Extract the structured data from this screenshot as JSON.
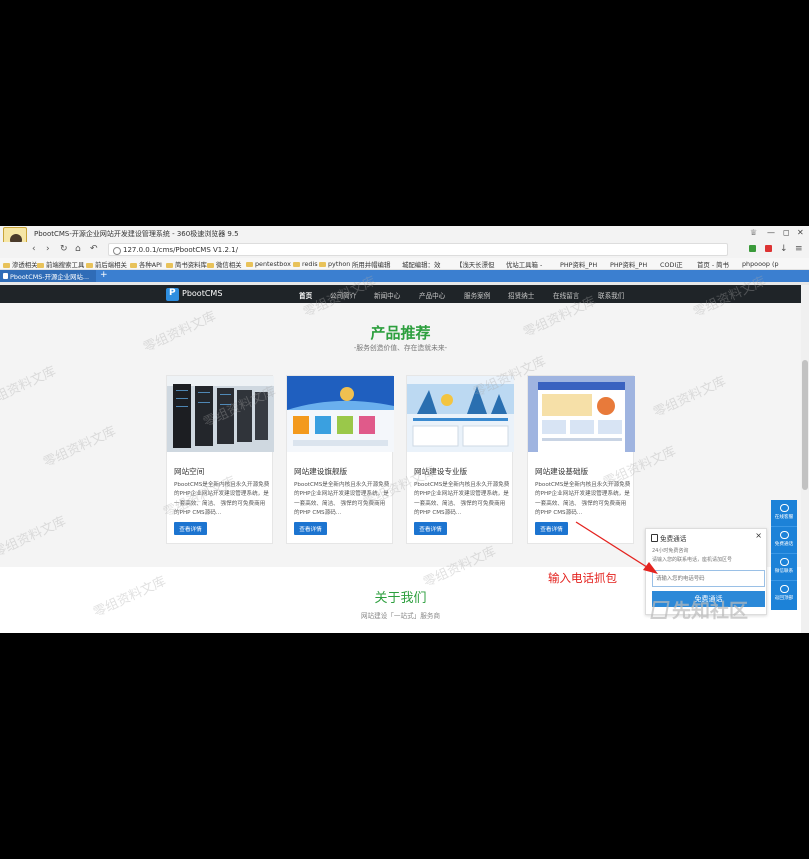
{
  "browser": {
    "window_title": "PbootCMS-开源企业网站开发建设管理系统 - 360极速浏览器 9.5",
    "url": "127.0.0.1/cms/PbootCMS V1.2.1/",
    "tab_title": "PbootCMS-开源企业网站...",
    "bookmarks": [
      "渗透相关",
      "前端搜索工具",
      "前后端相关",
      "各种API",
      "简书资料库",
      "微信相关",
      "pentestbox",
      "redis",
      "python",
      "所用并帽编辑",
      "城配编辑：效",
      "【浅天长漂但",
      "优站工具箱 -",
      "PHP资料_PH",
      "PHP资料_PH",
      "CODI正",
      "首页 - 简书",
      "phpooop (p"
    ]
  },
  "site": {
    "brand": "PbootCMS",
    "nav": [
      "首页",
      "公司简介",
      "新闻中心",
      "产品中心",
      "服务案例",
      "招贤纳士",
      "在线留言",
      "联系我们"
    ]
  },
  "products": {
    "title": "产品推荐",
    "subtitle": "-服务创造价值、存在造就未来-",
    "items": [
      {
        "name": "网站空间",
        "desc": "PbootCMS是全新内核且永久开源免费的PHP企业网站开发建设管理系统，是一套高效、简洁、 强悍的可免费商用的PHP CMS源码...",
        "button": "查看详情"
      },
      {
        "name": "网站建设旗舰版",
        "desc": "PbootCMS是全新内核且永久开源免费的PHP企业网站开发建设管理系统，是一套高效、简洁、 强悍的可免费商用的PHP CMS源码...",
        "button": "查看详情"
      },
      {
        "name": "网站建设专业版",
        "desc": "PbootCMS是全新内核且永久开源免费的PHP企业网站开发建设管理系统，是一套高效、简洁、 强悍的可免费商用的PHP CMS源码...",
        "button": "查看详情"
      },
      {
        "name": "网站建设基础版",
        "desc": "PbootCMS是全新内核且永久开源免费的PHP企业网站开发建设管理系统，是一套高效、简洁、 强悍的可免费商用的PHP CMS源码...",
        "button": "查看详情"
      }
    ]
  },
  "about": {
    "title": "关于我们",
    "subtitle": "网站建设「一站式」服务商"
  },
  "call_panel": {
    "title": "免费通话",
    "line1": "24小时免费咨询",
    "line2": "请输入您的联系电话，座机请加区号",
    "placeholder": "请输入您的电话号码",
    "button": "免费通话",
    "close": "×"
  },
  "side_buttons": [
    "在线客服",
    "免费通话",
    "微信联系",
    "返回顶部"
  ],
  "annotation": "输入电话抓包",
  "watermark_text": "零组资料文库",
  "site_logo_watermark": "先知社区"
}
